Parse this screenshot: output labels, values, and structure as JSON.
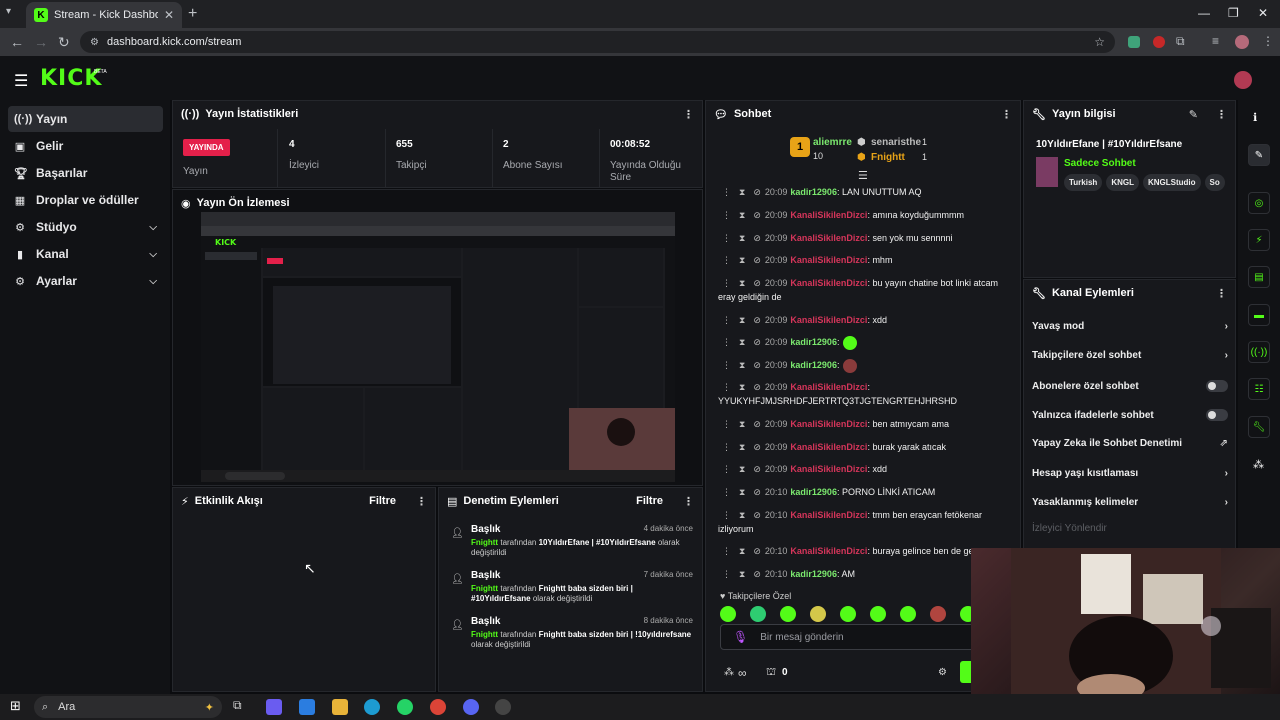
{
  "browser": {
    "tab_title": "Stream - Kick Dashboard",
    "url": "dashboard.kick.com/stream",
    "new_tab": "+",
    "close": "✕"
  },
  "header": {
    "logo": "KICK",
    "beta": "BETA"
  },
  "sidebar": {
    "items": [
      {
        "label": "Yayın",
        "icon": "broadcast-icon"
      },
      {
        "label": "Gelir",
        "icon": "money-icon"
      },
      {
        "label": "Başarılar",
        "icon": "trophy-icon"
      },
      {
        "label": "Droplar ve ödüller",
        "icon": "gift-icon"
      },
      {
        "label": "Stüdyo",
        "icon": "studio-icon"
      },
      {
        "label": "Kanal",
        "icon": "channel-icon"
      },
      {
        "label": "Ayarlar",
        "icon": "gear-icon"
      }
    ]
  },
  "stats": {
    "title": "Yayın İstatistikleri",
    "live_badge": "YAYINDA",
    "live_label": "Yayın",
    "viewers": "4",
    "viewers_label": "İzleyici",
    "followers": "655",
    "followers_label": "Takipçi",
    "subs": "2",
    "subs_label": "Abone Sayısı",
    "duration": "00:08:52",
    "duration_label": "Yayında Olduğu Süre"
  },
  "preview": {
    "title": "Yayın Ön İzlemesi"
  },
  "activity": {
    "title": "Etkinlik Akışı",
    "filter": "Filtre"
  },
  "moderation": {
    "title": "Denetim Eylemleri",
    "filter": "Filtre",
    "items": [
      {
        "title": "Başlık",
        "ago": "4 dakika önce",
        "user": "Fnightt",
        "by": "tarafından",
        "value": "10YıldırEfane | #10YıldırEfsane",
        "suffix": "olarak değiştirildi"
      },
      {
        "title": "Başlık",
        "ago": "7 dakika önce",
        "user": "Fnightt",
        "by": "tarafından",
        "value": "Fnightt baba sizden biri | #10YıldırEfsane",
        "suffix": "olarak değiştirildi"
      },
      {
        "title": "Başlık",
        "ago": "8 dakika önce",
        "user": "Fnightt",
        "by": "tarafından",
        "value": "Fnightt baba sizden biri | !10yıldırefsane",
        "suffix": "olarak değiştirildi"
      }
    ]
  },
  "chat": {
    "title": "Sohbet",
    "top_gifter": "aliemrre",
    "top_gifter_count": "10",
    "gifter2": "senaristhe",
    "gifter2_count": "1",
    "gifter3": "Fnightt",
    "gifter3_count": "1",
    "messages": [
      {
        "time": "20:09",
        "user": "kadir12906",
        "color": "green",
        "text": ": LAN UNUTTUM AQ"
      },
      {
        "time": "20:09",
        "user": "KanaliSikilenDizci",
        "color": "red",
        "text": ": amına koyduğummmm"
      },
      {
        "time": "20:09",
        "user": "KanaliSikilenDizci",
        "color": "red",
        "text": ": sen yok mu sennnni"
      },
      {
        "time": "20:09",
        "user": "KanaliSikilenDizci",
        "color": "red",
        "text": ": mhm"
      },
      {
        "time": "20:09",
        "user": "KanaliSikilenDizci",
        "color": "red",
        "text": ": bu yayın chatine bot linki atcam eray geldiğin de"
      },
      {
        "time": "20:09",
        "user": "KanaliSikilenDizci",
        "color": "red",
        "text": ": xdd"
      },
      {
        "time": "20:09",
        "user": "kadir12906",
        "color": "green",
        "text": ":"
      },
      {
        "time": "20:09",
        "user": "kadir12906",
        "color": "green",
        "text": ":"
      },
      {
        "time": "20:09",
        "user": "KanaliSikilenDizci",
        "color": "red",
        "text": ": YYUKYHFJMJSRHDFJERTRTQ3TJGTENGRTEHJHRSHD"
      },
      {
        "time": "20:09",
        "user": "KanaliSikilenDizci",
        "color": "red",
        "text": ": ben atmıycam ama"
      },
      {
        "time": "20:09",
        "user": "KanaliSikilenDizci",
        "color": "red",
        "text": ": burak yarak atıcak"
      },
      {
        "time": "20:09",
        "user": "KanaliSikilenDizci",
        "color": "red",
        "text": ": xdd"
      },
      {
        "time": "20:10",
        "user": "kadir12906",
        "color": "green",
        "text": ": PORNO LİNKİ ATICAM"
      },
      {
        "time": "20:10",
        "user": "KanaliSikilenDizci",
        "color": "red",
        "text": ": tmm ben eraycan fetökenar izliyorum"
      },
      {
        "time": "20:10",
        "user": "KanaliSikilenDizci",
        "color": "red",
        "text": ": buraya gelince ben de ge"
      },
      {
        "time": "20:10",
        "user": "kadir12906",
        "color": "green",
        "text": ": AM"
      }
    ],
    "followers_only": "Takipçilere Özel",
    "input_placeholder": "Bir mesaj gönderin",
    "points": "∞",
    "gift_count": "0"
  },
  "stream_info": {
    "title": "Yayın bilgisi",
    "stream_title": "10YıldırEfane | #10YıldırEfsane",
    "category": "Sadece Sohbet",
    "tags": [
      "Turkish",
      "KNGL",
      "KNGLStudio",
      "So"
    ]
  },
  "channel_actions": {
    "title": "Kanal Eylemleri",
    "items": [
      {
        "label": "Yavaş mod",
        "type": "chevron"
      },
      {
        "label": "Takipçilere özel sohbet",
        "type": "chevron"
      },
      {
        "label": "Abonelere özel sohbet",
        "type": "toggle"
      },
      {
        "label": "Yalnızca ifadelerle sohbet",
        "type": "toggle"
      },
      {
        "label": "Yapay Zeka ile Sohbet Denetimi",
        "type": "external"
      },
      {
        "label": "Hesap yaşı kısıtlaması",
        "type": "chevron"
      },
      {
        "label": "Yasaklanmış kelimeler",
        "type": "chevron"
      }
    ],
    "faded_item": "İzleyici Yönlendir"
  },
  "taskbar": {
    "search_placeholder": "Ara"
  },
  "colors": {
    "accent": "#53fc18",
    "live": "#e4204a",
    "red_user": "#d5355a",
    "green_user": "#7be86e"
  }
}
